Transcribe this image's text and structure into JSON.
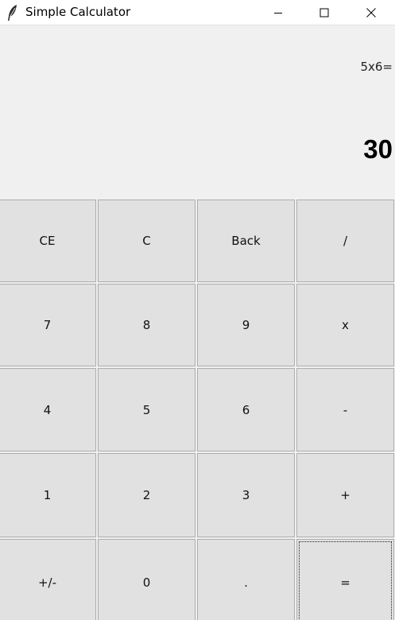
{
  "window": {
    "title": "Simple Calculator",
    "icon": "feather-icon",
    "controls": [
      "minimize-icon",
      "maximize-icon",
      "close-icon"
    ]
  },
  "display": {
    "expression": "5x6=",
    "result": "30"
  },
  "keypad": {
    "rows": [
      [
        "CE",
        "C",
        "Back",
        "/"
      ],
      [
        "7",
        "8",
        "9",
        "x"
      ],
      [
        "4",
        "5",
        "6",
        "-"
      ],
      [
        "1",
        "2",
        "3",
        "+"
      ],
      [
        "+/-",
        "0",
        ".",
        "="
      ]
    ],
    "focused_key": "="
  },
  "colors": {
    "button_face": "#e1e1e1",
    "button_border": "#adadad",
    "background": "#f0f0f0"
  }
}
